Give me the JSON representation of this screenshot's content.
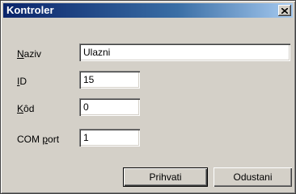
{
  "window": {
    "title": "Kontroler"
  },
  "form": {
    "fields": [
      {
        "label_pre": "",
        "label_mnemonic": "N",
        "label_post": "aziv",
        "value": "Ulazni"
      },
      {
        "label_pre": "",
        "label_mnemonic": "I",
        "label_post": "D",
        "value": "15"
      },
      {
        "label_pre": "",
        "label_mnemonic": "K",
        "label_post": "ôd",
        "value": "0"
      },
      {
        "label_pre": "COM ",
        "label_mnemonic": "p",
        "label_post": "ort",
        "value": "1"
      }
    ]
  },
  "buttons": {
    "ok_label": "Prihvati",
    "cancel_label": "Odustani"
  },
  "icons": {
    "close": "close-icon"
  }
}
